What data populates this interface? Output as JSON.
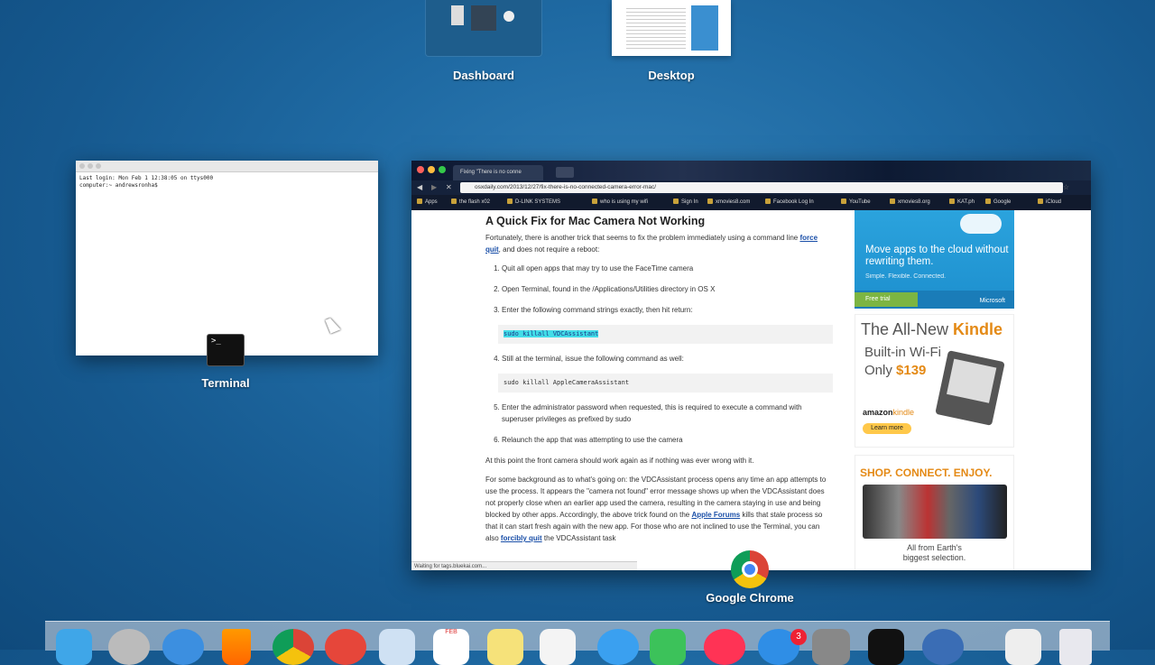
{
  "spaces": {
    "dashboard_label": "Dashboard",
    "desktop_label": "Desktop"
  },
  "terminal": {
    "label": "Terminal",
    "lines": [
      "Last login: Mon Feb  1 12:38:05 on ttys000",
      "computer:~ andrewsronha$ "
    ],
    "icon_glyph": ">_"
  },
  "chrome": {
    "label": "Google Chrome",
    "tab_title": "Fixing \"There is no conne",
    "url": "osxdaily.com/2013/12/27/fix-there-is-no-connected-camera-error-mac/",
    "bookmarks": [
      "Apps",
      "the flash x02",
      "D-LINK SYSTEMS",
      "who is using my wifi",
      "Sign In",
      "xmovies8.com",
      "Facebook Log In",
      "Pandora Internet...",
      "YouTube",
      "xmovies8.org",
      "KAT.ph",
      "Google",
      "iCloud"
    ],
    "status_text": "Waiting for tags.bluekai.com..."
  },
  "article": {
    "title": "A Quick Fix for Mac Camera Not Working",
    "intro_before": "Fortunately, there is another trick that seems to fix the problem immediately using a command line ",
    "intro_link": "force quit",
    "intro_after": ", and does not require a reboot:",
    "steps": [
      "Quit all open apps that may try to use the FaceTime camera",
      "Open Terminal, found in the /Applications/Utilities directory in OS X",
      "Enter the following command strings exactly, then hit return:",
      "Still at the terminal, issue the following command as well:",
      "Enter the administrator password when requested, this is required to execute a command with superuser privileges as prefixed by sudo",
      "Relaunch the app that was attempting to use the camera"
    ],
    "code1": "sudo killall VDCAssistant",
    "code2": "sudo killall AppleCameraAssistant",
    "para1": "At this point the front camera should work again as if nothing was ever wrong with it.",
    "para2_a": "For some background as to what's going on: the VDCAssistant process opens any time an app attempts to use the process. It appears the \"camera not found\" error message shows up when the VDCAssistant does not properly close when an earlier app used the camera, resulting in the camera staying in use and being blocked by other apps. Accordingly, the above trick found on the ",
    "para2_link1": "Apple Forums",
    "para2_b": " kills that stale process so that it can start fresh again with the new app. For those who are not inclined to use the Terminal, you can also ",
    "para2_link2": "forcibly quit",
    "para2_c": " the VDCAssistant task"
  },
  "ads": {
    "ms_headline": "Move apps to the cloud without rewriting them.",
    "ms_sub": "Simple. Flexible. Connected.",
    "ms_button": "Free trial",
    "ms_brand": "Microsoft",
    "kindle_prefix": "The All-New ",
    "kindle_word": "Kindle",
    "kindle_line2": "Built-in Wi-Fi",
    "kindle_only": "Only ",
    "kindle_price": "$139",
    "kindle_brand": "amazon",
    "kindle_brand2": "kindle",
    "kindle_button": "Learn more",
    "shop_headline": "SHOP. CONNECT. ENJOY.",
    "shop_caption1": "All from Earth's",
    "shop_caption2": "biggest selection."
  },
  "dock": {
    "badge_count": "3",
    "calendar_month": "FEB"
  }
}
